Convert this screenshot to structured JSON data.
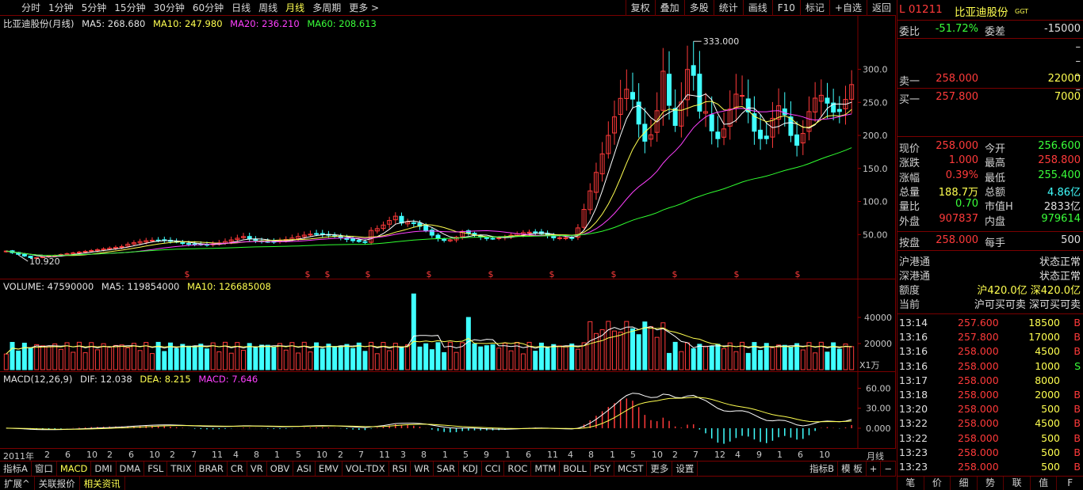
{
  "toolbar": {
    "periods": [
      "分时",
      "1分钟",
      "5分钟",
      "15分钟",
      "30分钟",
      "60分钟",
      "日线",
      "周线",
      "月线",
      "多周期",
      "更多 >"
    ],
    "active": "月线",
    "tools": [
      "复权",
      "叠加",
      "多股",
      "统计",
      "画线",
      "F10",
      "标记",
      "+自选",
      "返回"
    ]
  },
  "candle": {
    "title": "比亚迪股份(月线)",
    "ma5": "MA5: 268.680",
    "ma10": "MA10: 247.980",
    "ma20": "MA20: 236.210",
    "ma60": "MA60: 208.613",
    "high_label": "333.000",
    "low_label": "10.920",
    "yticks": [
      "300.0",
      "250.0",
      "200.0",
      "150.0",
      "100.0",
      "50.00"
    ],
    "marker": "$"
  },
  "volume": {
    "label": "VOLUME: 47590000",
    "ma5": "MA5: 119854000",
    "ma10": "MA10: 126685008",
    "yticks": [
      "40000",
      "20000"
    ],
    "unit": "X1万"
  },
  "macd": {
    "label": "MACD(12,26,9)",
    "dif": "DIF: 12.038",
    "dea": "DEA: 8.215",
    "macd": "MACD: 7.646",
    "yticks": [
      "60.00",
      "30.00",
      "0.000"
    ]
  },
  "dateaxis": {
    "start": "2011年",
    "period": "月线",
    "labels": [
      "2",
      "6",
      "10",
      "2",
      "6",
      "10",
      "2",
      "7",
      "11",
      "4",
      "8",
      "1",
      "5",
      "10",
      "2",
      "7",
      "11",
      "3",
      "8",
      "1",
      "5",
      "9",
      "1",
      "6",
      "11",
      "4",
      "8",
      "1",
      "5",
      "10",
      "2",
      "7",
      "12",
      "4",
      "9",
      "1",
      "6",
      "10"
    ]
  },
  "indicators": [
    "指标A",
    "窗口",
    "MACD",
    "DMI",
    "DMA",
    "FSL",
    "TRIX",
    "BRAR",
    "CR",
    "VR",
    "OBV",
    "ASI",
    "EMV",
    "VOL-TDX",
    "RSI",
    "WR",
    "SAR",
    "KDJ",
    "CCI",
    "ROC",
    "MTM",
    "BOLL",
    "PSY",
    "MCST",
    "更多",
    "设置"
  ],
  "indicators_right": [
    "指标B",
    "模 板",
    "+",
    "−"
  ],
  "bottom": [
    "扩展^",
    "关联报价",
    "相关资讯"
  ],
  "quote": {
    "header": {
      "code": "L  01211",
      "name": "比亚迪股份",
      "tag": "GGT"
    },
    "weibi": {
      "label": "委比",
      "value": "-51.72%",
      "label2": "委差",
      "value2": "-15000"
    },
    "dashes": [
      "–",
      "–",
      "–",
      "–"
    ],
    "sell1": {
      "label": "卖一",
      "price": "258.000",
      "vol": "22000"
    },
    "buy1": {
      "label": "买一",
      "price": "257.800",
      "vol": "7000"
    },
    "rows": [
      {
        "l": "现价",
        "v": "258.000",
        "c": "red",
        "l2": "今开",
        "v2": "256.600",
        "c2": "green"
      },
      {
        "l": "涨跌",
        "v": "1.000",
        "c": "red",
        "l2": "最高",
        "v2": "258.800",
        "c2": "red"
      },
      {
        "l": "涨幅",
        "v": "0.39%",
        "c": "red",
        "l2": "最低",
        "v2": "255.400",
        "c2": "green"
      },
      {
        "l": "总量",
        "v": "188.7万",
        "c": "yel",
        "l2": "总额",
        "v2": "4.86亿",
        "c2": "cyan"
      },
      {
        "l": "量比",
        "v": "0.70",
        "c": "green",
        "l2": "市值H",
        "v2": "2833亿",
        "c2": "white"
      },
      {
        "l": "外盘",
        "v": "907837",
        "c": "red",
        "l2": "内盘",
        "v2": "979614",
        "c2": "green"
      }
    ],
    "anpan": {
      "l": "按盘",
      "v": "258.000",
      "l2": "每手",
      "v2": "500"
    },
    "hk": [
      {
        "l": "沪港通",
        "v": "状态正常"
      },
      {
        "l": "深港通",
        "v": "状态正常"
      },
      {
        "l": "额度",
        "v": "沪420.0亿 深420.0亿"
      },
      {
        "l": "当前",
        "v": "沪可买可卖 深可买可卖"
      }
    ],
    "ticks": [
      {
        "t": "13:14",
        "p": "257.600",
        "v": "18500",
        "s": "B"
      },
      {
        "t": "13:16",
        "p": "257.800",
        "v": "17000",
        "s": "B"
      },
      {
        "t": "13:16",
        "p": "258.000",
        "v": "4500",
        "s": "B"
      },
      {
        "t": "13:16",
        "p": "258.000",
        "v": "1000",
        "s": "S"
      },
      {
        "t": "13:17",
        "p": "258.000",
        "v": "8000",
        "s": ""
      },
      {
        "t": "13:18",
        "p": "258.000",
        "v": "2000",
        "s": "B"
      },
      {
        "t": "13:20",
        "p": "258.000",
        "v": "500",
        "s": "B"
      },
      {
        "t": "13:22",
        "p": "258.000",
        "v": "4500",
        "s": "B"
      },
      {
        "t": "13:22",
        "p": "258.000",
        "v": "500",
        "s": "B"
      },
      {
        "t": "13:23",
        "p": "258.000",
        "v": "500",
        "s": "B"
      },
      {
        "t": "13:23",
        "p": "258.000",
        "v": "500",
        "s": "B"
      }
    ],
    "tabs": [
      "笔",
      "价",
      "细",
      "势",
      "联",
      "值",
      "F"
    ]
  },
  "colors": {
    "up": "#ff3a3a",
    "down": "#40ffff",
    "ma5": "#ffffff",
    "ma10": "#ffff50",
    "ma20": "#ff40ff",
    "ma60": "#30ff30",
    "border": "#7a0000"
  }
}
